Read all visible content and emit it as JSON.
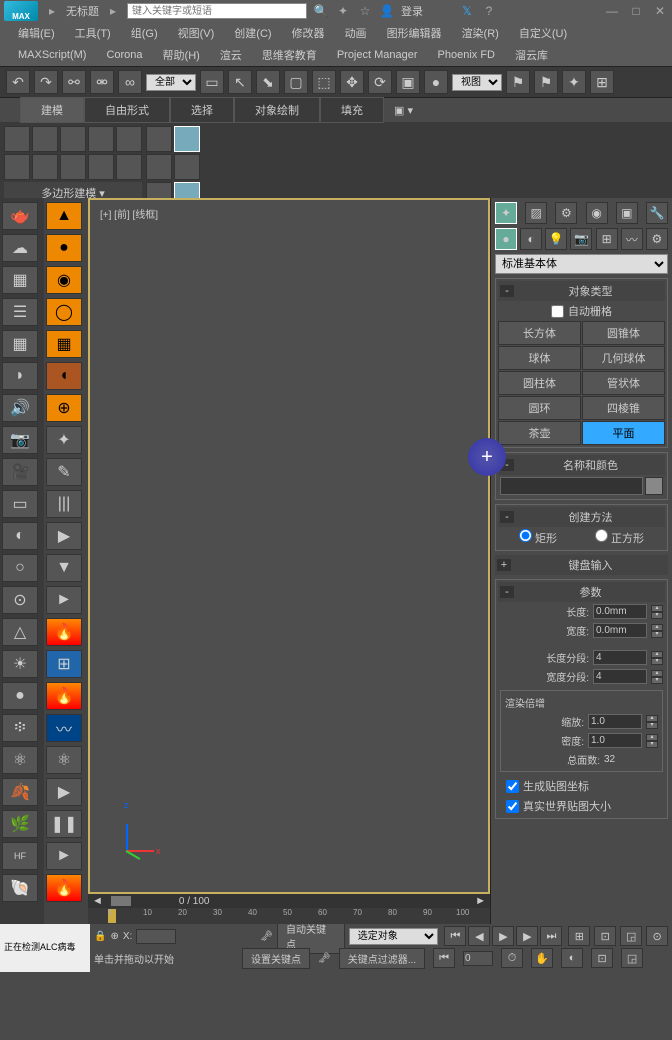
{
  "app": {
    "title": "无标题",
    "logo": "MAX",
    "login": "登录"
  },
  "search": {
    "placeholder": "键入关键字或短语"
  },
  "menu1": {
    "edit": "编辑(E)",
    "tools": "工具(T)",
    "group": "组(G)",
    "view": "视图(V)",
    "create": "创建(C)",
    "modifiers": "修改器",
    "anim": "动画",
    "graph": "图形编辑器",
    "render": "渲染(R)",
    "custom": "自定义(U)"
  },
  "menu2": {
    "maxscript": "MAXScript(M)",
    "corona": "Corona",
    "help": "帮助(H)",
    "vray": "渲云",
    "swk": "思维客教育",
    "proj": "Project Manager",
    "phoenix": "Phoenix FD",
    "liuyun": "溜云库"
  },
  "toolbar": {
    "all": "全部",
    "view": "视图"
  },
  "ribbon": {
    "tabs": {
      "model": "建模",
      "freeform": "自由形式",
      "select": "选择",
      "objpaint": "对象绘制",
      "fill": "填充"
    },
    "poly": "多边形建模"
  },
  "viewport": {
    "label": "[+] [前] [线框]"
  },
  "panel": {
    "dropdown": "标准基本体",
    "objtype": {
      "header": "对象类型",
      "autogrid": "自动栅格",
      "box": "长方体",
      "cone": "圆锥体",
      "sphere": "球体",
      "geosphere": "几何球体",
      "cylinder": "圆柱体",
      "tube": "管状体",
      "torus": "圆环",
      "pyramid": "四棱锥",
      "teapot": "茶壶",
      "plane": "平面"
    },
    "namecolor": {
      "header": "名称和颜色"
    },
    "creation": {
      "header": "创建方法",
      "rect": "矩形",
      "square": "正方形"
    },
    "keyboard": {
      "header": "键盘输入"
    },
    "params": {
      "header": "参数",
      "length": "长度:",
      "width": "宽度:",
      "lenval": "0.0mm",
      "widval": "0.0mm",
      "lseg": "长度分段:",
      "wseg": "宽度分段:",
      "lsegval": "4",
      "wsegval": "4"
    },
    "rendermult": {
      "header": "渲染倍增",
      "scale": "缩放:",
      "density": "密度:",
      "scaleval": "1.0",
      "densval": "1.0",
      "faces": "总面数:",
      "facesval": "32"
    },
    "genmap": "生成贴图坐标",
    "realworld": "真实世界贴图大小"
  },
  "timeline": {
    "frame": "0 / 100",
    "marks": [
      "0",
      "10",
      "20",
      "30",
      "40",
      "50",
      "60",
      "70",
      "80",
      "90",
      "100"
    ]
  },
  "bottom": {
    "status": "正在检测ALC病毒",
    "hint": "单击并拖动以开始",
    "autokey": "自动关键点",
    "setkey": "设置关键点",
    "selobj": "选定对象",
    "keyfilter": "关键点过滤器...",
    "framenum": "0"
  }
}
